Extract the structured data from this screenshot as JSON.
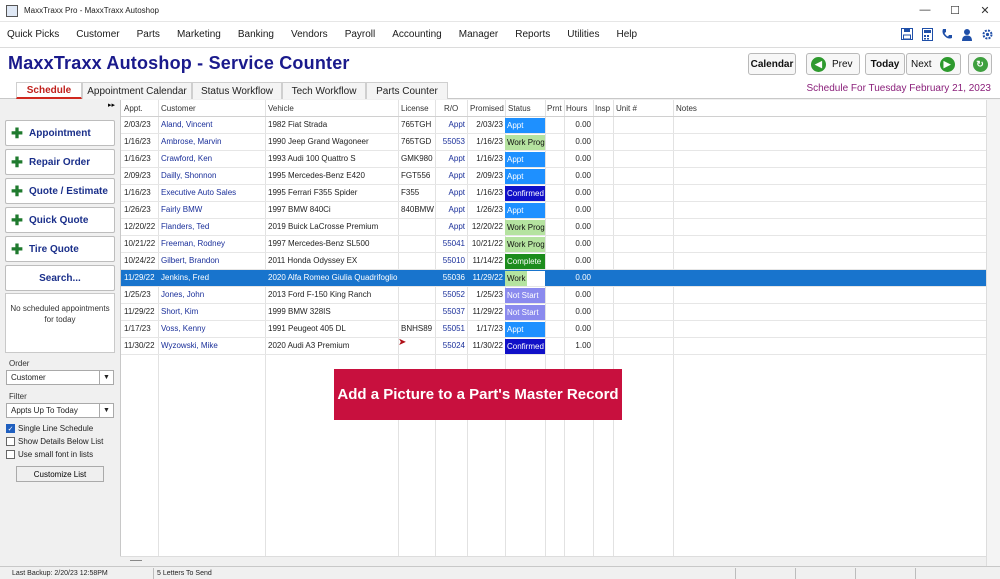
{
  "window": {
    "title": "MaxxTraxx Pro - MaxxTraxx Autoshop",
    "minimize": "—",
    "maximize": "☐",
    "close": "✕"
  },
  "menu": [
    "Quick Picks",
    "Customer",
    "Parts",
    "Marketing",
    "Banking",
    "Vendors",
    "Payroll",
    "Accounting",
    "Manager",
    "Reports",
    "Utilities",
    "Help"
  ],
  "toolbar_icons": [
    "save-icon",
    "calculator-icon",
    "phone-icon",
    "user-icon",
    "gear-icon"
  ],
  "header": {
    "title": "MaxxTraxx Autoshop - Service Counter",
    "calendar": "Calendar",
    "prev": "Prev",
    "today": "Today",
    "next": "Next"
  },
  "tabs": [
    "Schedule",
    "Appointment Calendar",
    "Status Workflow",
    "Tech Workflow",
    "Parts Counter"
  ],
  "schedule_for": "Schedule For Tuesday February 21, 2023",
  "sidebar": {
    "buttons": [
      "Appointment",
      "Repair Order",
      "Quote / Estimate",
      "Quick Quote",
      "Tire Quote"
    ],
    "search": "Search...",
    "no_appointments": "No scheduled appointments for today",
    "order_label": "Order",
    "order_value": "Customer",
    "filter_label": "Filter",
    "filter_value": "Appts Up To Today",
    "checks": [
      {
        "label": "Single Line Schedule",
        "checked": true
      },
      {
        "label": "Show Details Below List",
        "checked": false
      },
      {
        "label": "Use small font in lists",
        "checked": false
      }
    ],
    "customize": "Customize List"
  },
  "columns": [
    "Appt.",
    "Customer",
    "Vehicle",
    "License",
    "R/O",
    "Promised",
    "Status",
    "Prnt",
    "Hours",
    "Insp",
    "Unit #",
    "Notes"
  ],
  "rows": [
    {
      "appt": "2/03/23",
      "customer": "Aland, Vincent",
      "vehicle": "1982 Fiat  Strada",
      "license": "765TGH",
      "ro": "Appt",
      "promised": "2/03/23",
      "status": "Appt",
      "status_color": "#1e90ff",
      "hours": "0.00"
    },
    {
      "appt": "1/16/23",
      "customer": "Ambrose, Marvin",
      "vehicle": "1990 Jeep  Grand Wagoneer",
      "license": "765TGD",
      "ro": "55053",
      "promised": "1/16/23",
      "status": "Work Prog",
      "status_color": "#b5e3a0",
      "hours": "0.00"
    },
    {
      "appt": "1/16/23",
      "customer": "Crawford, Ken",
      "vehicle": "1993 Audi  100 Quattro S",
      "license": "GMK980",
      "ro": "Appt",
      "promised": "1/16/23",
      "status": "Appt",
      "status_color": "#1e90ff",
      "hours": "0.00"
    },
    {
      "appt": "2/09/23",
      "customer": "Dailly, Shonnon",
      "vehicle": "1995 Mercedes-Benz  E420",
      "license": "FGT556",
      "ro": "Appt",
      "promised": "2/09/23",
      "status": "Appt",
      "status_color": "#1e90ff",
      "hours": "0.00"
    },
    {
      "appt": "1/16/23",
      "customer": "Executive Auto Sales",
      "vehicle": "1995 Ferrari  F355 Spider",
      "license": "F355",
      "ro": "Appt",
      "promised": "1/16/23",
      "status": "Confirmed",
      "status_color": "#1010c8",
      "hours": "0.00"
    },
    {
      "appt": "1/26/23",
      "customer": "Fairly BMW",
      "vehicle": "1997 BMW  840Ci",
      "license": "840BMW",
      "ro": "Appt",
      "promised": "1/26/23",
      "status": "Appt",
      "status_color": "#1e90ff",
      "hours": "0.00"
    },
    {
      "appt": "12/20/22",
      "customer": "Flanders, Ted",
      "vehicle": "2019 Buick  LaCrosse Premium",
      "license": "",
      "ro": "Appt",
      "promised": "12/20/22",
      "status": "Work Prog",
      "status_color": "#b5e3a0",
      "hours": "0.00"
    },
    {
      "appt": "10/21/22",
      "customer": "Freeman, Rodney",
      "vehicle": "1997 Mercedes-Benz  SL500",
      "license": "",
      "ro": "55041",
      "promised": "10/21/22",
      "status": "Work Prog",
      "status_color": "#b5e3a0",
      "hours": "0.00"
    },
    {
      "appt": "10/24/22",
      "customer": "Gilbert, Brandon",
      "vehicle": "2011 Honda  Odyssey EX",
      "license": "",
      "ro": "55010",
      "promised": "11/14/22",
      "status": "Complete",
      "status_color": "#1c8c1c",
      "hours": "0.00"
    },
    {
      "appt": "11/29/22",
      "customer": "Jenkins, Fred",
      "vehicle": "2020 Alfa Romeo  Giulia Quadrifoglio",
      "license": "",
      "ro": "55036",
      "promised": "11/29/22",
      "status": "Work Prog",
      "status_color": "#b5e3a0",
      "hours": "0.00",
      "selected": true
    },
    {
      "appt": "1/25/23",
      "customer": "Jones, John",
      "vehicle": "2013 Ford  F-150 King Ranch",
      "license": "",
      "ro": "55052",
      "promised": "1/25/23",
      "status": "Not Start",
      "status_color": "#8a8aee",
      "hours": "0.00"
    },
    {
      "appt": "11/29/22",
      "customer": "Short, Kim",
      "vehicle": "1999 BMW  328IS",
      "license": "",
      "ro": "55037",
      "promised": "11/29/22",
      "status": "Not Start",
      "status_color": "#8a8aee",
      "hours": "0.00"
    },
    {
      "appt": "1/17/23",
      "customer": "Voss, Kenny",
      "vehicle": "1991 Peugeot  405 DL",
      "license": "BNHS89",
      "ro": "55051",
      "promised": "1/17/23",
      "status": "Appt",
      "status_color": "#1e90ff",
      "hours": "0.00"
    },
    {
      "appt": "11/30/22",
      "customer": "Wyzowski, Mike",
      "vehicle": "2020 Audi  A3 Premium",
      "license": "",
      "ro": "55024",
      "promised": "11/30/22",
      "status": "Confirmed",
      "status_color": "#1010c8",
      "hours": "1.00"
    }
  ],
  "banner": "Add a Picture to a Part's Master Record",
  "statusbar": {
    "backup": "Last Backup:  2/20/23  12:58PM",
    "letters": "5 Letters To Send"
  }
}
